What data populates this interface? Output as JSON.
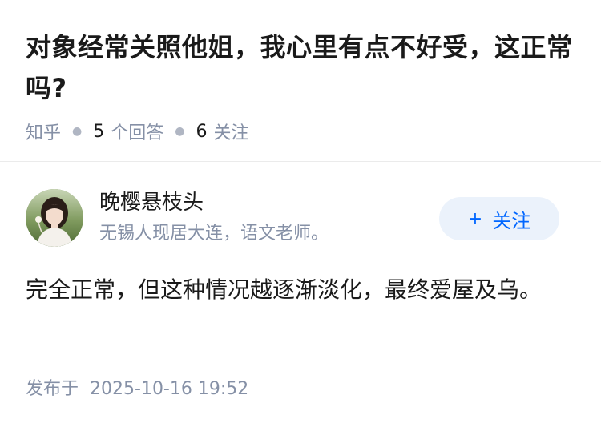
{
  "question": {
    "title": "对象经常关照他姐，我心里有点不好受，这正常吗?",
    "source": "知乎",
    "answer_count": "5",
    "answer_label": "个回答",
    "follower_count": "6",
    "follower_label": "关注"
  },
  "author": {
    "name": "晚樱悬枝头",
    "bio": "无锡人现居大连，语文老师。",
    "follow_plus": "+",
    "follow_label": "关注"
  },
  "answer": {
    "text": "完全正常，但这种情况越逐渐淡化，最终爱屋及乌。",
    "published_label": "发布于",
    "published_time": "2025-10-16 19:52"
  }
}
